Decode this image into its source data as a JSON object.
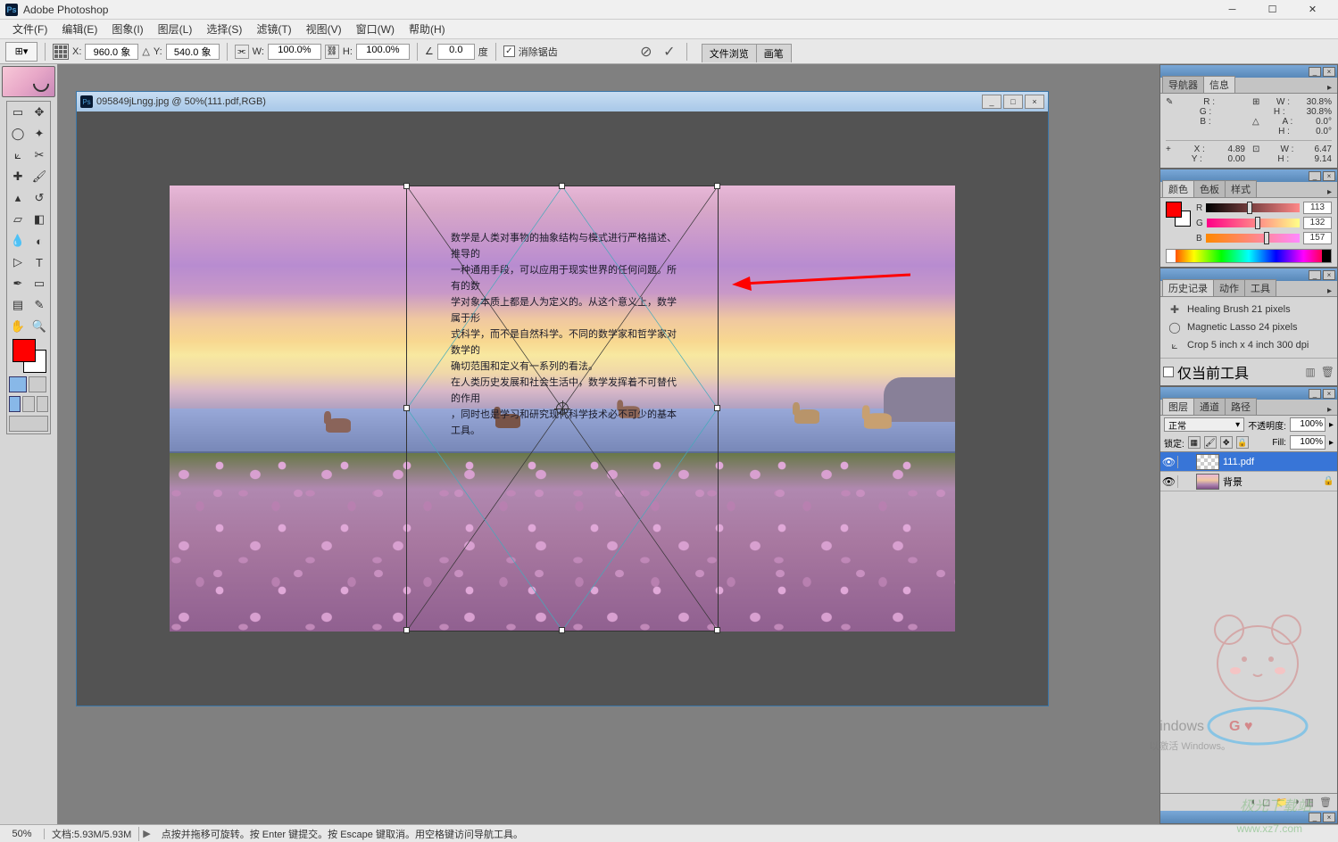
{
  "app": {
    "title": "Adobe Photoshop"
  },
  "menu": [
    "文件(F)",
    "编辑(E)",
    "图象(I)",
    "图层(L)",
    "选择(S)",
    "滤镜(T)",
    "视图(V)",
    "窗口(W)",
    "帮助(H)"
  ],
  "options": {
    "x_label": "X:",
    "x_value": "960.0 象",
    "y_label": "Y:",
    "y_value": "540.0 象",
    "w_label": "W:",
    "w_value": "100.0%",
    "h_label": "H:",
    "h_value": "100.0%",
    "angle_label": "∠",
    "angle_value": "0.0",
    "angle_unit": "度",
    "antialias": "消除锯齿",
    "tabs": [
      "文件浏览",
      "画笔"
    ]
  },
  "document": {
    "title": "095849jLngg.jpg @ 50%(111.pdf,RGB)"
  },
  "canvas_text": [
    "数学是人类对事物的抽象结构与模式进行严格描述、推导的",
    "一种通用手段，可以应用于现实世界的任何问题。所有的数",
    "学对象本质上都是人为定义的。从这个意义上，数学属于形",
    "式科学，而不是自然科学。不同的数学家和哲学家对数学的",
    "确切范围和定义有一系列的看法。",
    "在人类历史发展和社会生活中，数学发挥着不可替代的作用",
    "，同时也是学习和研究现代科学技术必不可少的基本工具。"
  ],
  "panels": {
    "navigator": {
      "tabs": [
        "导航器",
        "信息"
      ],
      "info": {
        "r": "R :",
        "r_val": "",
        "g": "G :",
        "g_val": "",
        "b": "B :",
        "b_val": "",
        "w": "W :",
        "w_val": "30.8%",
        "h": "H :",
        "h_val": "30.8%",
        "a": "A :",
        "a_val": "0.0°",
        "h2": "H :",
        "h2_val": "0.0°",
        "x": "X :",
        "x_val": "4.89",
        "y": "Y :",
        "y_val": "0.00",
        "w2": "W :",
        "w2_val": "6.47",
        "h3": "H :",
        "h3_val": "9.14"
      }
    },
    "color": {
      "tabs": [
        "颜色",
        "色板",
        "样式"
      ],
      "r": "R",
      "r_val": "113",
      "g": "G",
      "g_val": "132",
      "b": "B",
      "b_val": "157"
    },
    "history": {
      "tabs": [
        "历史记录",
        "动作",
        "工具"
      ],
      "items": [
        {
          "icon": "brush",
          "label": "Healing Brush 21 pixels"
        },
        {
          "icon": "lasso",
          "label": "Magnetic Lasso 24 pixels"
        },
        {
          "icon": "crop",
          "label": "Crop 5 inch x 4 inch 300 dpi"
        }
      ],
      "footer_label": "仅当前工具"
    },
    "layers": {
      "tabs": [
        "图层",
        "通道",
        "路径"
      ],
      "blend_mode": "正常",
      "opacity_label": "不透明度:",
      "opacity_value": "100%",
      "lock_label": "锁定:",
      "fill_label": "Fill:",
      "fill_value": "100%",
      "items": [
        {
          "name": "111.pdf",
          "selected": true,
          "thumb": "checker"
        },
        {
          "name": "背景",
          "selected": false,
          "thumb": "photo",
          "locked": true
        }
      ]
    }
  },
  "status": {
    "zoom": "50%",
    "doc": "文档:5.93M/5.93M",
    "hint": "点按并拖移可旋转。按 Enter 键提交。按 Escape 键取消。用空格键访问导航工具。"
  },
  "watermark": {
    "brand": "极光下载站",
    "url": "www.xz7.com"
  },
  "windows_hint": {
    "line1": "indows",
    "line2": "以激活 Windows。"
  }
}
